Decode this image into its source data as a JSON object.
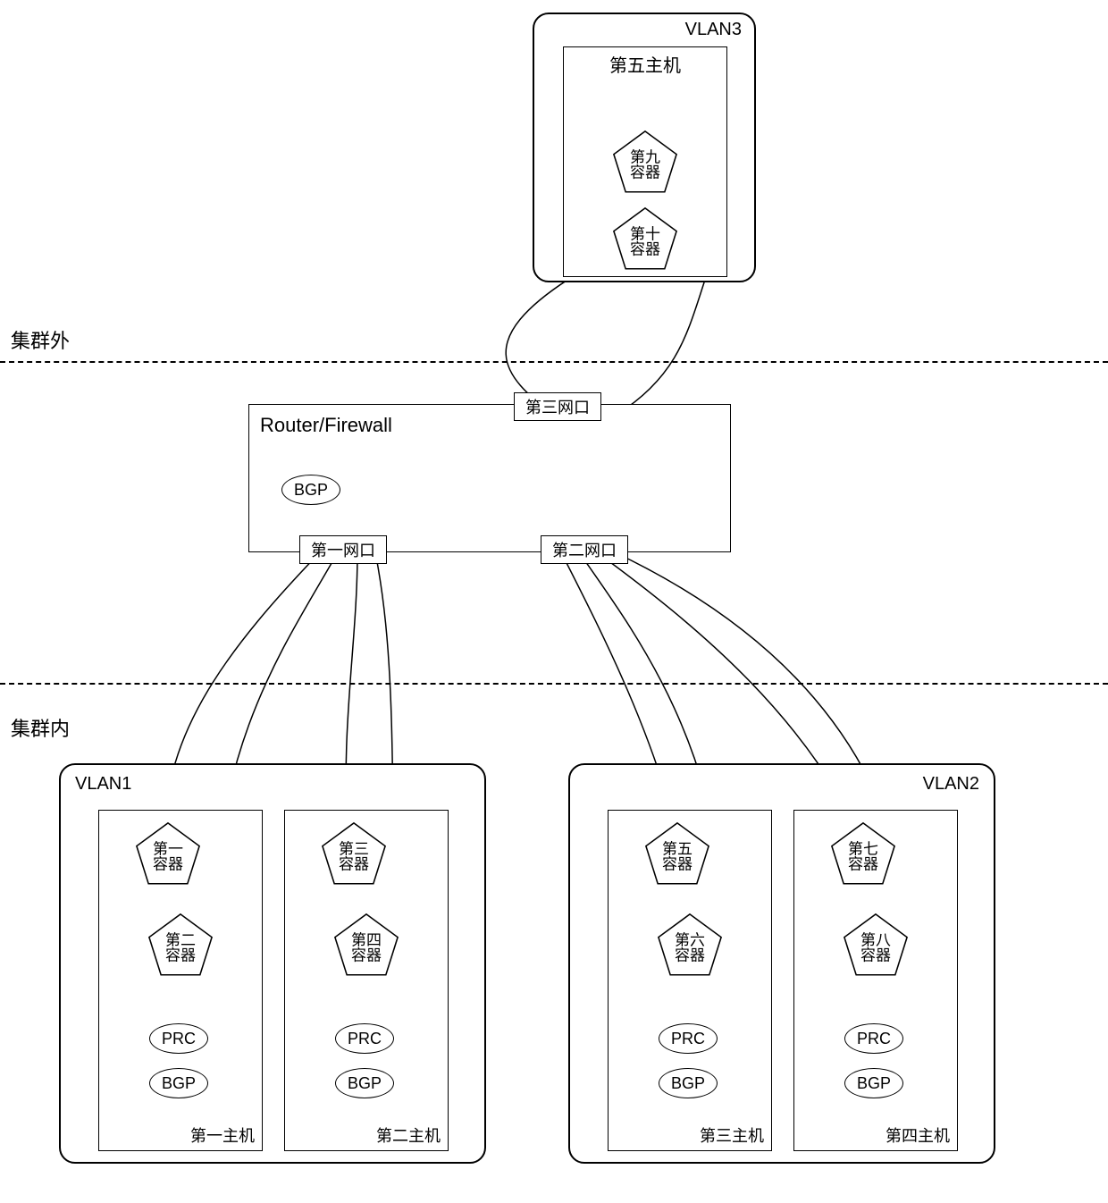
{
  "labels": {
    "outside_cluster": "集群外",
    "inside_cluster": "集群内"
  },
  "vlan3": {
    "title": "VLAN3",
    "host5": {
      "title": "第五主机",
      "container9": {
        "l1": "第九",
        "l2": "容器"
      },
      "container10": {
        "l1": "第十",
        "l2": "容器"
      }
    }
  },
  "router": {
    "title": "Router/Firewall",
    "port3": "第三网口",
    "port1": "第一网口",
    "port2": "第二网口",
    "bgp": "BGP"
  },
  "vlan1": {
    "title": "VLAN1",
    "host1": {
      "bottom": "第一主机",
      "container1": {
        "l1": "第一",
        "l2": "容器"
      },
      "container2": {
        "l1": "第二",
        "l2": "容器"
      },
      "prc": "PRC",
      "bgp": "BGP"
    },
    "host2": {
      "bottom": "第二主机",
      "container3": {
        "l1": "第三",
        "l2": "容器"
      },
      "container4": {
        "l1": "第四",
        "l2": "容器"
      },
      "prc": "PRC",
      "bgp": "BGP"
    }
  },
  "vlan2": {
    "title": "VLAN2",
    "host3": {
      "bottom": "第三主机",
      "container5": {
        "l1": "第五",
        "l2": "容器"
      },
      "container6": {
        "l1": "第六",
        "l2": "容器"
      },
      "prc": "PRC",
      "bgp": "BGP"
    },
    "host4": {
      "bottom": "第四主机",
      "container7": {
        "l1": "第七",
        "l2": "容器"
      },
      "container8": {
        "l1": "第八",
        "l2": "容器"
      },
      "prc": "PRC",
      "bgp": "BGP"
    }
  }
}
